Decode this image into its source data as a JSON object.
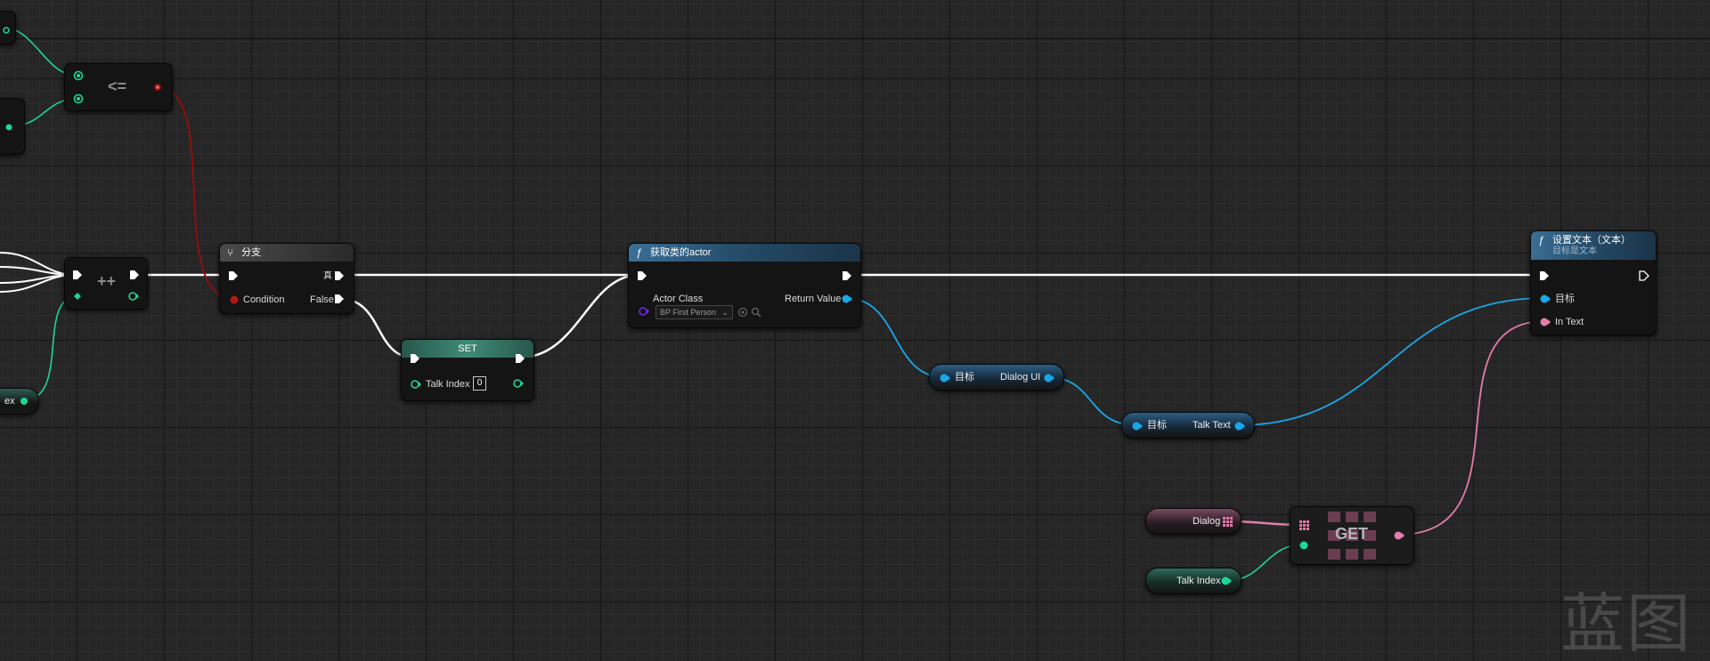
{
  "colors": {
    "exec": "#ffffff",
    "bool": "#8c1010",
    "int": "#1ed69a",
    "object": "#1aa7e8",
    "text": "#e37daa",
    "class": "#5b14c8",
    "function_header": "#2a5878",
    "set_header": "#2f6f5e"
  },
  "nodes": {
    "less_equal": {
      "label": "<="
    },
    "increment": {
      "label": "++"
    },
    "branch": {
      "title": "分支",
      "icon": "branch-icon",
      "pin_true": "真",
      "pin_condition": "Condition",
      "pin_false": "False"
    },
    "set": {
      "title": "SET",
      "pin_talk_index": "Talk Index",
      "value": "0"
    },
    "get_actor": {
      "title": "获取类的actor",
      "icon": "function-icon",
      "pin_actor_class": "Actor Class",
      "pin_return": "Return Value",
      "class_value": "BP First Person"
    },
    "dialog_ui_get": {
      "target": "目标",
      "output": "Dialog UI"
    },
    "talk_text_get": {
      "target": "目标",
      "output": "Talk Text"
    },
    "set_text": {
      "title": "设置文本（文本）",
      "subtitle": "目标是文本",
      "icon": "function-icon",
      "pin_target": "目标",
      "pin_in_text": "In Text"
    },
    "dialog_var": {
      "label": "Dialog"
    },
    "talk_index_var": {
      "label": "Talk Index"
    },
    "array_get": {
      "label": "GET"
    },
    "partial_var": {
      "label": "ex"
    }
  },
  "watermark": "蓝图"
}
